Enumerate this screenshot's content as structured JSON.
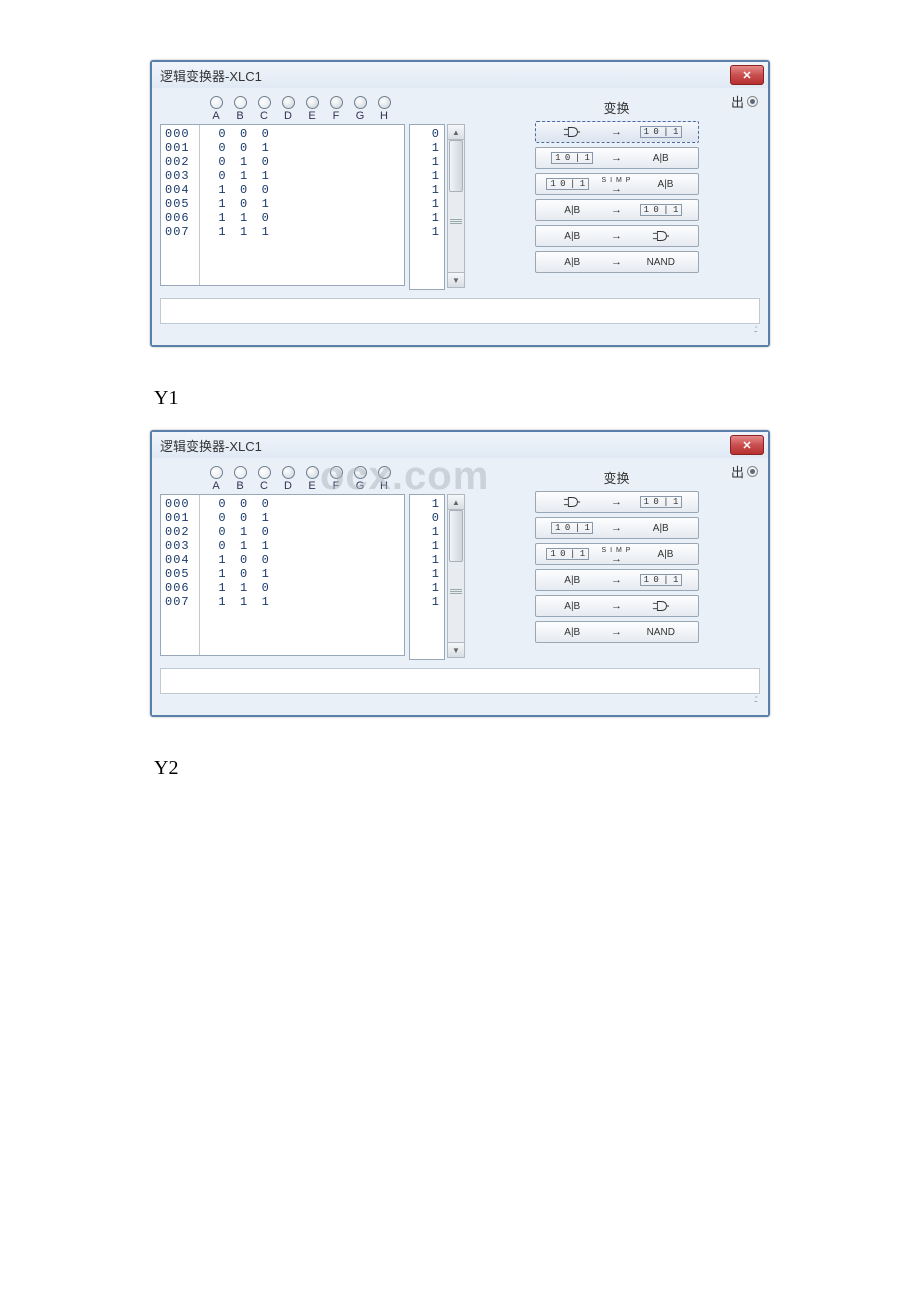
{
  "captions": {
    "y1": "Y1",
    "y2": "Y2"
  },
  "windows": [
    {
      "title": "逻辑变换器-XLC1",
      "out_label": "出",
      "convert_title": "变换",
      "columns": [
        "A",
        "B",
        "C",
        "D",
        "E",
        "F",
        "G",
        "H"
      ],
      "active_cols": 3,
      "rows": [
        {
          "idx": "000",
          "abc": [
            "0",
            "0",
            "0"
          ],
          "out": "0"
        },
        {
          "idx": "001",
          "abc": [
            "0",
            "0",
            "1"
          ],
          "out": "1"
        },
        {
          "idx": "002",
          "abc": [
            "0",
            "1",
            "0"
          ],
          "out": "1"
        },
        {
          "idx": "003",
          "abc": [
            "0",
            "1",
            "1"
          ],
          "out": "1"
        },
        {
          "idx": "004",
          "abc": [
            "1",
            "0",
            "0"
          ],
          "out": "1"
        },
        {
          "idx": "005",
          "abc": [
            "1",
            "0",
            "1"
          ],
          "out": "1"
        },
        {
          "idx": "006",
          "abc": [
            "1",
            "1",
            "0"
          ],
          "out": "1"
        },
        {
          "idx": "007",
          "abc": [
            "1",
            "1",
            "1"
          ],
          "out": "1"
        }
      ],
      "selected_button": 0,
      "buttons": [
        {
          "left": "gate",
          "mid": "→",
          "right": "101"
        },
        {
          "left": "101",
          "mid": "→",
          "right": "AIB"
        },
        {
          "left": "101",
          "mid": "SIMP",
          "right": "AIB"
        },
        {
          "left": "AIB",
          "mid": "→",
          "right": "101"
        },
        {
          "left": "AIB",
          "mid": "→",
          "right": "gate"
        },
        {
          "left": "AIB",
          "mid": "→",
          "right": "NAND"
        }
      ]
    },
    {
      "title": "逻辑变换器-XLC1",
      "out_label": "出",
      "convert_title": "变换",
      "columns": [
        "A",
        "B",
        "C",
        "D",
        "E",
        "F",
        "G",
        "H"
      ],
      "active_cols": 3,
      "rows": [
        {
          "idx": "000",
          "abc": [
            "0",
            "0",
            "0"
          ],
          "out": "1"
        },
        {
          "idx": "001",
          "abc": [
            "0",
            "0",
            "1"
          ],
          "out": "0"
        },
        {
          "idx": "002",
          "abc": [
            "0",
            "1",
            "0"
          ],
          "out": "1"
        },
        {
          "idx": "003",
          "abc": [
            "0",
            "1",
            "1"
          ],
          "out": "1"
        },
        {
          "idx": "004",
          "abc": [
            "1",
            "0",
            "0"
          ],
          "out": "1"
        },
        {
          "idx": "005",
          "abc": [
            "1",
            "0",
            "1"
          ],
          "out": "1"
        },
        {
          "idx": "006",
          "abc": [
            "1",
            "1",
            "0"
          ],
          "out": "1"
        },
        {
          "idx": "007",
          "abc": [
            "1",
            "1",
            "1"
          ],
          "out": "1"
        }
      ],
      "selected_button": -1,
      "buttons": [
        {
          "left": "gate",
          "mid": "→",
          "right": "101"
        },
        {
          "left": "101",
          "mid": "→",
          "right": "AIB"
        },
        {
          "left": "101",
          "mid": "SIMP",
          "right": "AIB"
        },
        {
          "left": "AIB",
          "mid": "→",
          "right": "101"
        },
        {
          "left": "AIB",
          "mid": "→",
          "right": "gate"
        },
        {
          "left": "AIB",
          "mid": "→",
          "right": "NAND"
        }
      ]
    }
  ],
  "watermark": "ocx.com"
}
